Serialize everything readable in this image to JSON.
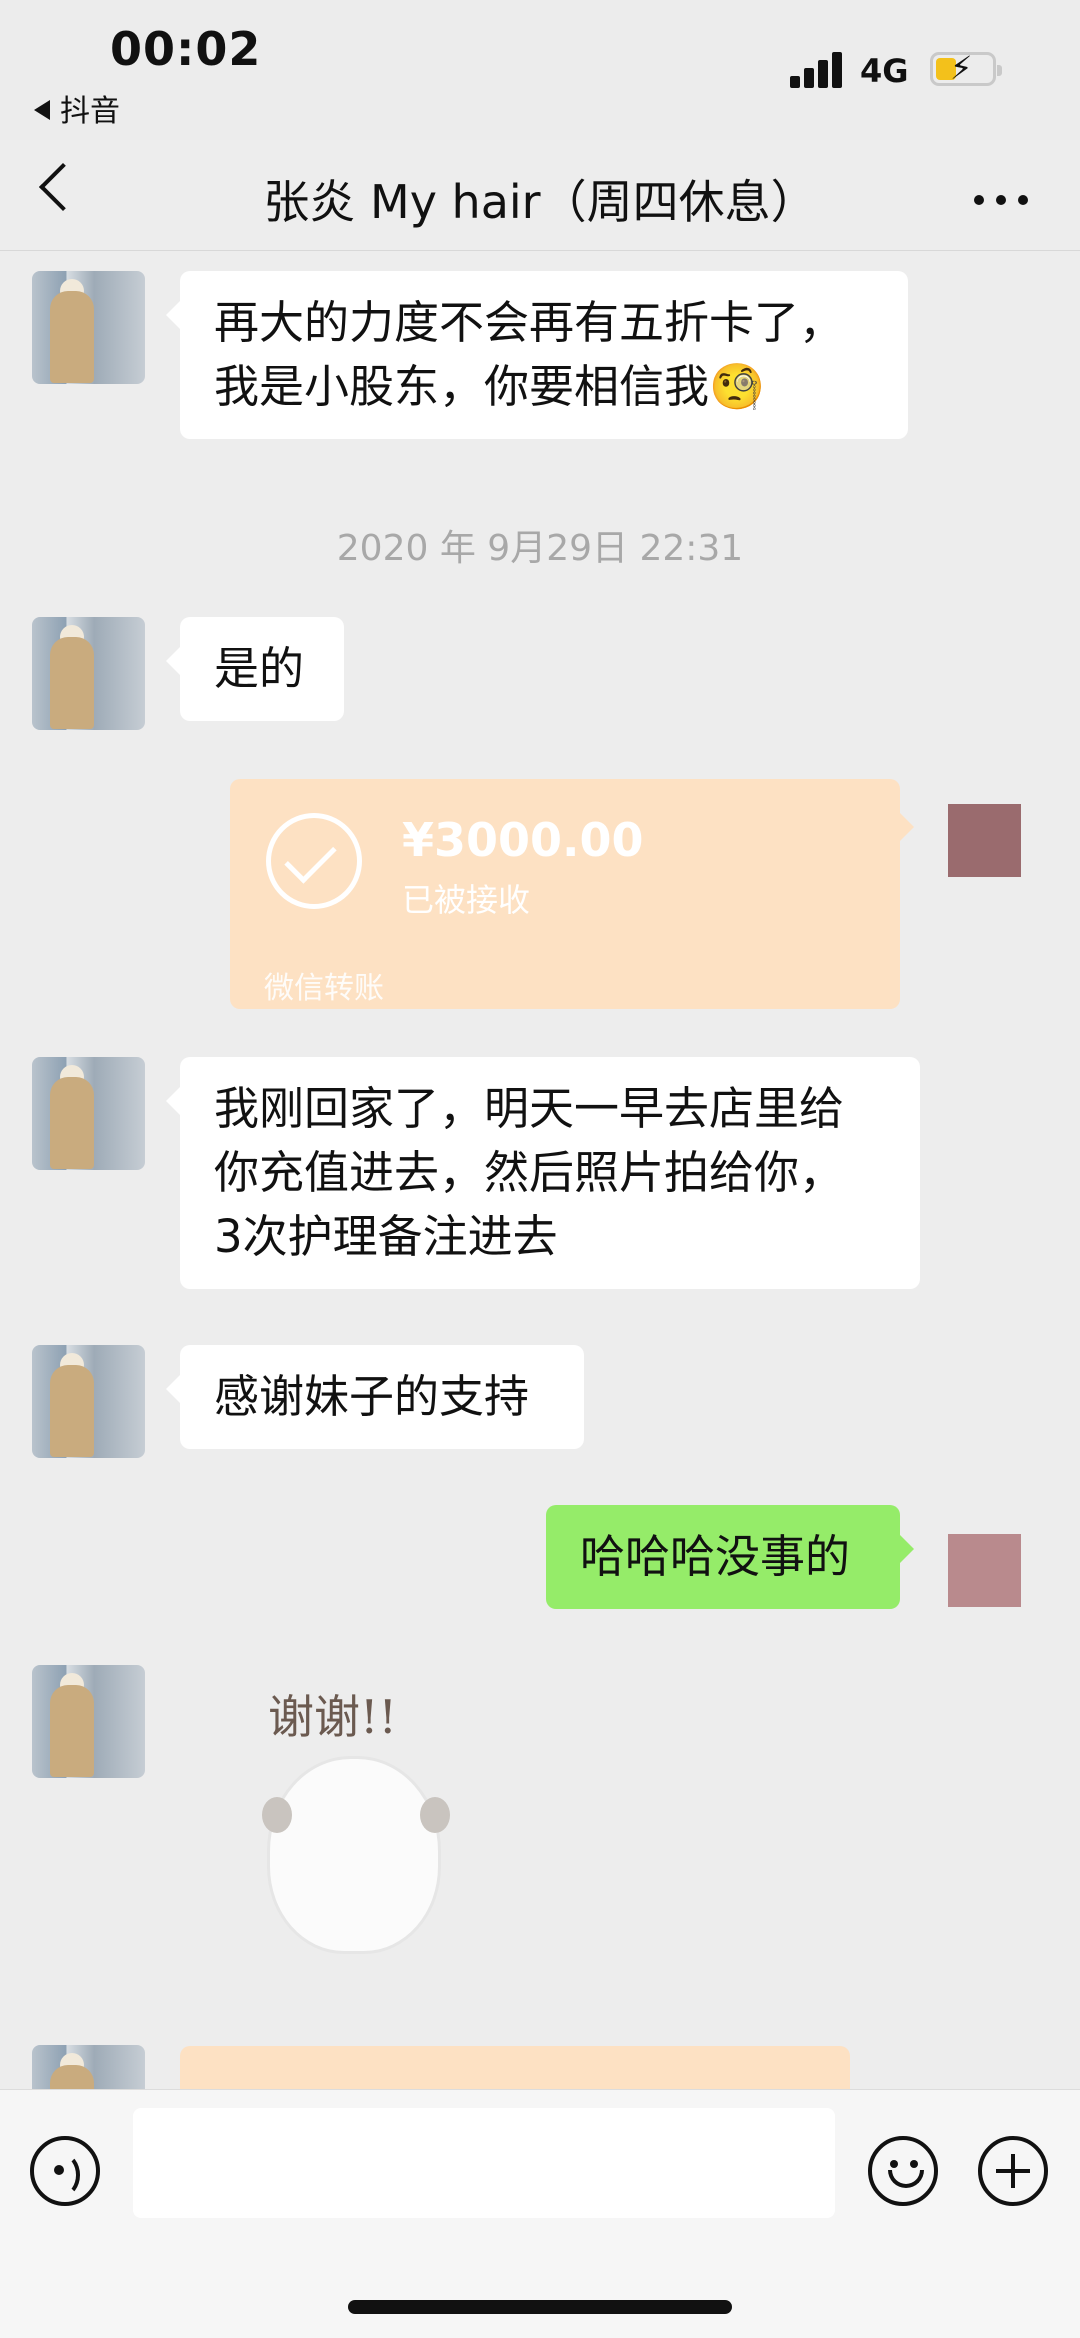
{
  "status_bar": {
    "time": "00:02",
    "back_app": "抖音",
    "network": "4G"
  },
  "header": {
    "title": "张炎 My hair（周四休息）"
  },
  "messages": [
    {
      "type": "text",
      "side": "left",
      "text": "再大的力度不会再有五折卡了，\n我是小股东，你要相信我🧐"
    },
    {
      "type": "timestamp",
      "text": "2020 年 9月29日 22:31"
    },
    {
      "type": "text",
      "side": "left",
      "text": "是的"
    },
    {
      "type": "transfer",
      "side": "right",
      "amount": "¥3000.00",
      "status": "已被接收",
      "footer": "微信转账"
    },
    {
      "type": "text",
      "side": "left",
      "text": "我刚回家了，明天一早去店里给\n你充值进去，然后照片拍给你，\n3次护理备注进去"
    },
    {
      "type": "text",
      "side": "left",
      "text": "感谢妹子的支持"
    },
    {
      "type": "text",
      "side": "right",
      "text": "哈哈哈没事的"
    },
    {
      "type": "sticker",
      "side": "left",
      "caption": "谢谢!!"
    }
  ],
  "colors": {
    "background": "#ededed",
    "bubble_left": "#ffffff",
    "bubble_right": "#95ec69",
    "transfer": "#fde1c3"
  },
  "input_bar": {
    "voice_icon": "voice-icon",
    "emoji_icon": "emoji-icon",
    "plus_icon": "plus-icon"
  }
}
